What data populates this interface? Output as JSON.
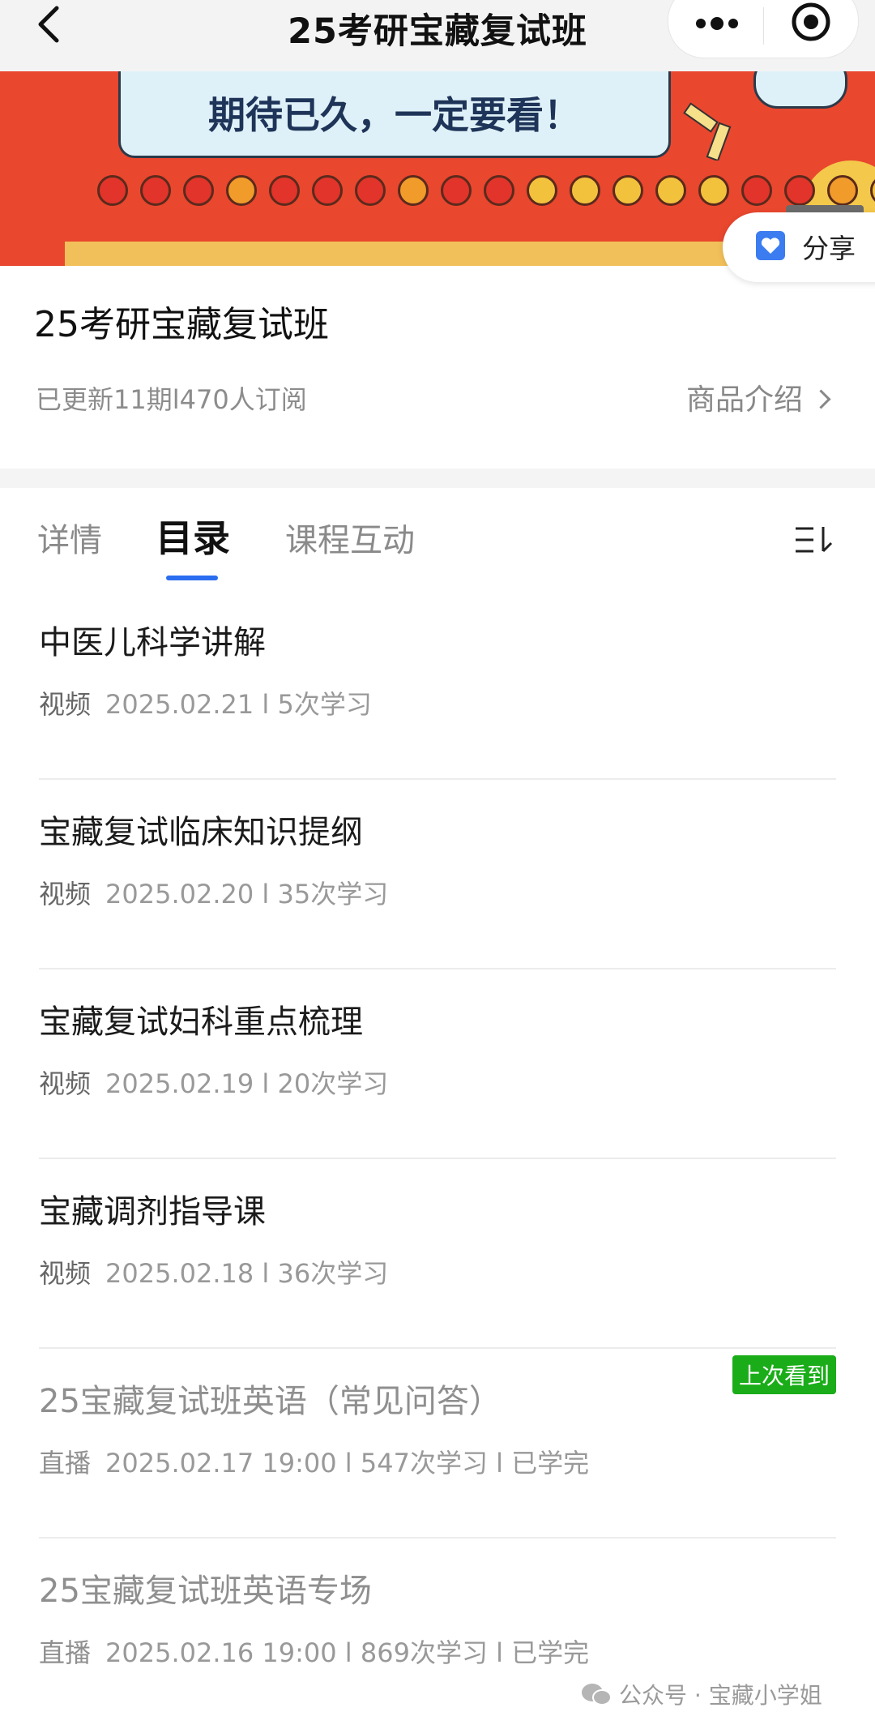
{
  "nav": {
    "title": "25考研宝藏复试班"
  },
  "banner": {
    "headline": "期待已久，一定要看！",
    "dot_colors": [
      "#e2342a",
      "#e2342a",
      "#e2342a",
      "#f09b2a",
      "#e2342a",
      "#e2342a",
      "#e2342a",
      "#f09b2a",
      "#e2342a",
      "#e2342a",
      "#f3c23d",
      "#f3c23d",
      "#f3c23d",
      "#f3c23d",
      "#f3c23d",
      "#e2342a",
      "#e2342a",
      "#f09b2a",
      "#f3c23d"
    ]
  },
  "share": {
    "label": "分享"
  },
  "course": {
    "title": "25考研宝藏复试班",
    "meta": "已更新11期l470人订阅",
    "intro_link": "商品介绍"
  },
  "tabs": [
    {
      "label": "详情",
      "active": false
    },
    {
      "label": "目录",
      "active": true
    },
    {
      "label": "课程互动",
      "active": false
    }
  ],
  "lessons": [
    {
      "title": "中医儿科学讲解",
      "type": "视频",
      "info": "2025.02.21 l 5次学习"
    },
    {
      "title": "宝藏复试临床知识提纲",
      "type": "视频",
      "info": "2025.02.20 l 35次学习"
    },
    {
      "title": "宝藏复试妇科重点梳理",
      "type": "视频",
      "info": "2025.02.19 l 20次学习"
    },
    {
      "title": "宝藏调剂指导课",
      "type": "视频",
      "info": "2025.02.18 l 36次学习"
    },
    {
      "title": "25宝藏复试班英语（常见问答）",
      "type": "直播",
      "info": "2025.02.17 19:00 l 547次学习 l 已学完",
      "badge": "上次看到"
    },
    {
      "title": "25宝藏复试班英语专场",
      "type": "直播",
      "info": "2025.02.16 19:00 l 869次学习 l 已学完"
    }
  ],
  "watermark": "公众号 · 宝藏小学姐",
  "colors": {
    "accent": "#2a6df0",
    "badge_green": "#1aad19",
    "banner_red": "#e9472e"
  }
}
